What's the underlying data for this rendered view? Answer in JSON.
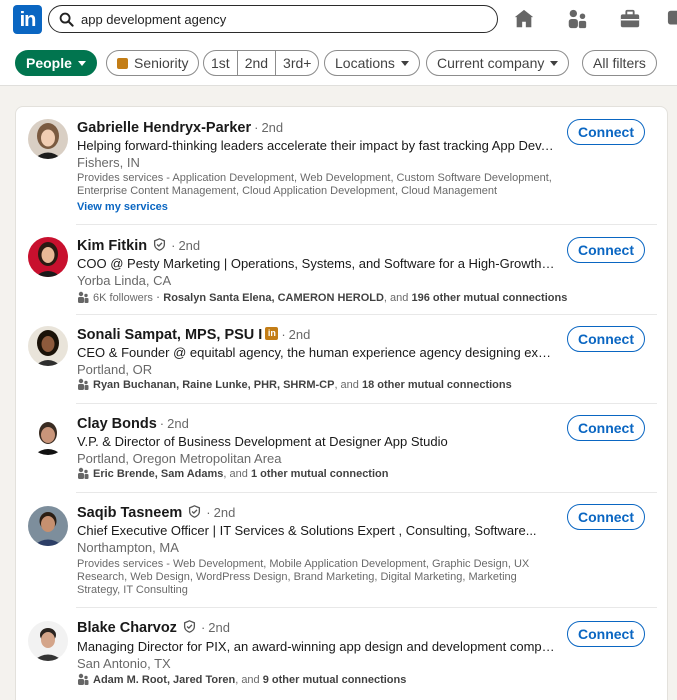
{
  "brand": {
    "logo_text": "in",
    "color": "#0a66c2"
  },
  "search": {
    "value": "app development agency",
    "icon": "search-icon"
  },
  "nav_icons": [
    "home-icon",
    "my-network-icon",
    "jobs-icon",
    "messaging-icon"
  ],
  "filters": {
    "people": "People",
    "seniority": "Seniority",
    "degrees": [
      "1st",
      "2nd",
      "3rd+"
    ],
    "locations": "Locations",
    "current_company": "Current company",
    "all_filters": "All filters",
    "active_color": "#01754f"
  },
  "results": [
    {
      "name": "Gabrielle Hendryx-Parker",
      "degree": "2nd",
      "headline": "Helping forward-thinking leaders accelerate their impact by fast tracking App Dev, AI/ML...",
      "location": "Fishers, IN",
      "services": "Provides services - Application Development, Web Development, Custom Software Development, Enterprise Content Management, Cloud Application Development, Cloud Management",
      "view_services": "View my services",
      "connect": "Connect"
    },
    {
      "name": "Kim Fitkin",
      "degree": "2nd",
      "verified": true,
      "headline": "COO @ Pesty Marketing | Operations, Systems, and Software for a High-Growth Vertical...",
      "location": "Yorba Linda, CA",
      "mutual_prefix": "6K followers",
      "mutual_names": "Rosalyn Santa Elena, CAMERON HEROLD",
      "mutual_and": ", and ",
      "mutual_count": "196 other mutual connections",
      "connect": "Connect"
    },
    {
      "name": "Sonali Sampat, MPS, PSU I",
      "degree": "2nd",
      "headline": "CEO & Founder @ equitabl agency, the human experience agency designing exceptional...",
      "location": "Portland, OR",
      "mutual_names": "Ryan Buchanan, Raine Lunke, PHR, SHRM-CP",
      "mutual_and": ", and ",
      "mutual_count": "18 other mutual connections",
      "connect": "Connect"
    },
    {
      "name": "Clay Bonds",
      "degree": "2nd",
      "headline": "V.P. & Director of Business Development at Designer App Studio",
      "location": "Portland, Oregon Metropolitan Area",
      "mutual_names": "Eric Brende, Sam Adams",
      "mutual_and": ", and ",
      "mutual_count": "1 other mutual connection",
      "connect": "Connect"
    },
    {
      "name": "Saqib Tasneem",
      "degree": "2nd",
      "verified": true,
      "headline": "Chief Executive Officer | IT Services & Solutions Expert , Consulting, Software...",
      "location": "Northampton, MA",
      "services": "Provides services - Web Development, Mobile Application Development, Graphic Design, UX Research, Web Design, WordPress Design, Brand Marketing, Digital Marketing, Marketing Strategy, IT Consulting",
      "connect": "Connect"
    },
    {
      "name": "Blake Charvoz",
      "degree": "2nd",
      "verified": true,
      "headline": "Managing Director for PIX, an award-winning app design and development company...",
      "location": "San Antonio, TX",
      "mutual_names": "Adam M. Root, Jared Toren",
      "mutual_and": ", and ",
      "mutual_count": "9 other mutual connections",
      "connect": "Connect"
    }
  ]
}
